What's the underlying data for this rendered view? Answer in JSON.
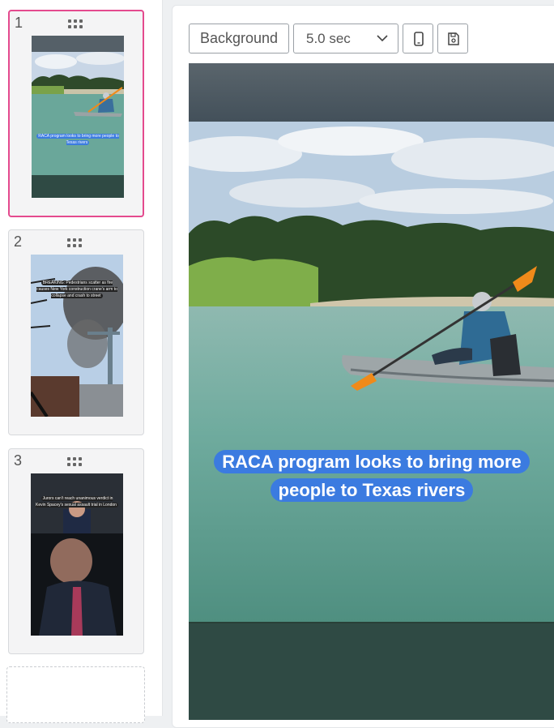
{
  "slides": [
    {
      "number": "1",
      "caption": "RACA program looks to bring more people to Texas rivers"
    },
    {
      "number": "2",
      "caption": "BREAKING: Pedestrians scatter as fire causes New York construction crane's arm to collapse and crash to street"
    },
    {
      "number": "3",
      "caption": "Jurors can't reach unanimous verdict in Kevin Spacey's sexual assault trial in London"
    }
  ],
  "toolbar": {
    "background_label": "Background",
    "duration_value": "5.0 sec"
  },
  "canvas": {
    "caption_line1": "RACA program looks to bring more",
    "caption_line2": "people to Texas rivers"
  },
  "colors": {
    "active_border": "#e44a8e",
    "caption_pill": "#3b7be0"
  },
  "icons": [
    "drag-handle-icon",
    "chevron-down-icon",
    "phone-icon",
    "save-icon"
  ]
}
